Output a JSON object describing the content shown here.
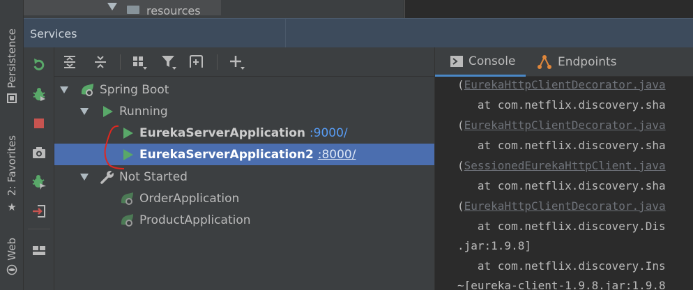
{
  "left_strip": {
    "tabs": [
      {
        "label": "Persistence",
        "icon": "persistence-icon"
      },
      {
        "label": "2: Favorites",
        "icon": "star-icon"
      },
      {
        "label": "Web",
        "icon": "web-icon"
      }
    ]
  },
  "project_tree": {
    "partial_item": "resources"
  },
  "services": {
    "title": "Services"
  },
  "tree": {
    "spring_boot": "Spring Boot",
    "running": "Running",
    "app1_name": "EurekaServerApplication",
    "app1_port": ":9000/",
    "app2_name": "EurekaServerApplication2",
    "app2_port": ":8000/",
    "not_started": "Not Started",
    "order_app": "OrderApplication",
    "product_app": "ProductApplication"
  },
  "console": {
    "tab_console": "Console",
    "tab_endpoints": "Endpoints",
    "lines": [
      {
        "paren": "(",
        "link": "EurekaHttpClientDecorator.java"
      },
      {
        "text": "   at com.netflix.discovery.sha"
      },
      {
        "paren": "(",
        "link": "EurekaHttpClientDecorator.java"
      },
      {
        "text": "   at com.netflix.discovery.sha"
      },
      {
        "paren": "(",
        "link": "SessionedEurekaHttpClient.java"
      },
      {
        "text": "   at com.netflix.discovery.sha"
      },
      {
        "paren": "(",
        "link": "EurekaHttpClientDecorator.java"
      },
      {
        "text": "   at com.netflix.discovery.Dis"
      },
      {
        "text": ".jar:1.9.8]"
      },
      {
        "text": "   at com.netflix.discovery.Ins"
      },
      {
        "text": "~[eureka-client-1.9.8.jar:1.9.8"
      }
    ]
  },
  "colors": {
    "selection": "#4b6eaf",
    "run_green": "#59a869",
    "port_blue": "#589df6",
    "stop_red": "#c75450",
    "annotation_red": "#e0271f"
  }
}
